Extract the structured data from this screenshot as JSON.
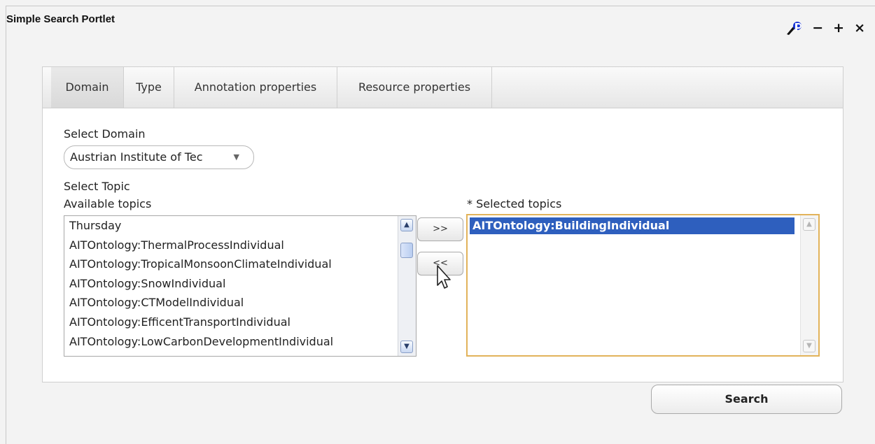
{
  "portlet": {
    "title": "Simple Search Portlet"
  },
  "window_controls": {
    "minimize": "−",
    "maximize": "+",
    "close": "×"
  },
  "tabs": [
    {
      "label": "Domain",
      "active": true
    },
    {
      "label": "Type"
    },
    {
      "label": "Annotation properties"
    },
    {
      "label": "Resource properties"
    }
  ],
  "domain": {
    "label": "Select Domain",
    "selected": "Austrian Institute of Tec"
  },
  "topic": {
    "label": "Select Topic",
    "available_label": "Available topics",
    "selected_label": "* Selected topics",
    "available": [
      "Thursday",
      "AITOntology:ThermalProcessIndividual",
      "AITOntology:TropicalMonsoonClimateIndividual",
      "AITOntology:SnowIndividual",
      "AITOntology:CTModelIndividual",
      "AITOntology:EfficentTransportIndividual",
      "AITOntology:LowCarbonDevelopmentIndividual"
    ],
    "selected": [
      "AITOntology:BuildingIndividual"
    ]
  },
  "buttons": {
    "add": ">>",
    "remove": "<<",
    "search": "Search"
  },
  "icons": [
    "config-icon",
    "minimize-icon",
    "maximize-icon",
    "close-icon",
    "scroll-up-icon",
    "scroll-down-icon",
    "dropdown-arrow-icon",
    "mouse-cursor-icon"
  ]
}
